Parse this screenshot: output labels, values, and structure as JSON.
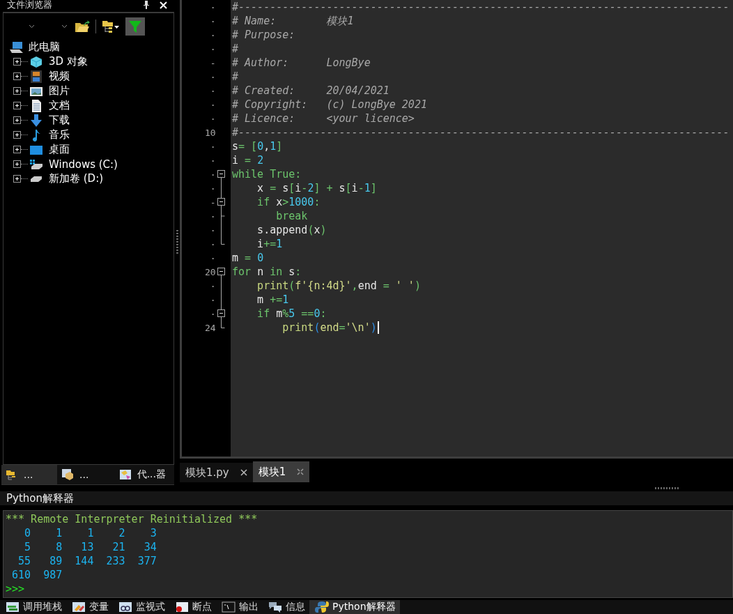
{
  "file_browser": {
    "title": "文件浏览器",
    "filter_on": true,
    "tree": {
      "label": "此电脑",
      "kind": "computer",
      "expanded": true,
      "children": [
        {
          "label": "3D 对象",
          "kind": "cube",
          "expanded": false
        },
        {
          "label": "视频",
          "kind": "film",
          "expanded": false
        },
        {
          "label": "图片",
          "kind": "image",
          "expanded": false
        },
        {
          "label": "文档",
          "kind": "doc",
          "expanded": false
        },
        {
          "label": "下载",
          "kind": "download",
          "expanded": false
        },
        {
          "label": "音乐",
          "kind": "music",
          "expanded": false
        },
        {
          "label": "桌面",
          "kind": "desktop",
          "expanded": false
        },
        {
          "label": "Windows (C:)",
          "kind": "windrive",
          "expanded": false
        },
        {
          "label": "新加卷 (D:)",
          "kind": "drive",
          "expanded": false
        }
      ]
    },
    "tabs": [
      {
        "label": "...",
        "kind": "folder",
        "selected": true
      },
      {
        "label": "...",
        "kind": "box",
        "selected": false
      },
      {
        "label": "代...器",
        "kind": "code",
        "selected": false
      }
    ]
  },
  "editor": {
    "lines": [
      {
        "gutter": "·",
        "tokens": [
          {
            "kind": "comment",
            "text": "#------------------------------------------------------------------------------"
          }
        ]
      },
      {
        "gutter": "·",
        "tokens": [
          {
            "kind": "comment",
            "text": "# Name:        模块1"
          }
        ]
      },
      {
        "gutter": "·",
        "tokens": [
          {
            "kind": "comment",
            "text": "# Purpose:"
          }
        ]
      },
      {
        "gutter": "·",
        "tokens": [
          {
            "kind": "comment",
            "text": "#"
          }
        ]
      },
      {
        "gutter": "-",
        "tokens": [
          {
            "kind": "comment",
            "text": "# Author:      LongBye"
          }
        ]
      },
      {
        "gutter": "·",
        "tokens": [
          {
            "kind": "comment",
            "text": "#"
          }
        ]
      },
      {
        "gutter": "·",
        "tokens": [
          {
            "kind": "comment",
            "text": "# Created:     20/04/2021"
          }
        ]
      },
      {
        "gutter": "·",
        "tokens": [
          {
            "kind": "comment",
            "text": "# Copyright:   (c) LongBye 2021"
          }
        ]
      },
      {
        "gutter": "·",
        "tokens": [
          {
            "kind": "comment",
            "text": "# Licence:     <your licence>"
          }
        ]
      },
      {
        "gutter": "10",
        "tokens": [
          {
            "kind": "comment",
            "text": "#------------------------------------------------------------------------------"
          }
        ]
      },
      {
        "gutter": "·",
        "tokens": [
          {
            "kind": "name",
            "text": "s"
          },
          {
            "kind": "op",
            "text": "= ["
          },
          {
            "kind": "number",
            "text": "0"
          },
          {
            "kind": "name",
            "text": ","
          },
          {
            "kind": "number",
            "text": "1"
          },
          {
            "kind": "op",
            "text": "]"
          }
        ]
      },
      {
        "gutter": "·",
        "tokens": [
          {
            "kind": "name",
            "text": "i "
          },
          {
            "kind": "op",
            "text": "= "
          },
          {
            "kind": "number",
            "text": "2"
          }
        ]
      },
      {
        "gutter": "·",
        "fold": {
          "kind": "open"
        },
        "tokens": [
          {
            "kind": "keyword",
            "text": "while True:"
          }
        ]
      },
      {
        "gutter": "·",
        "fold": {
          "kind": "bar"
        },
        "tokens": [
          {
            "kind": "name",
            "text": "    x "
          },
          {
            "kind": "op",
            "text": "= "
          },
          {
            "kind": "name",
            "text": "s"
          },
          {
            "kind": "op",
            "text": "["
          },
          {
            "kind": "name",
            "text": "i"
          },
          {
            "kind": "op",
            "text": "-"
          },
          {
            "kind": "number",
            "text": "2"
          },
          {
            "kind": "op",
            "text": "] + "
          },
          {
            "kind": "name",
            "text": "s"
          },
          {
            "kind": "op",
            "text": "["
          },
          {
            "kind": "name",
            "text": "i"
          },
          {
            "kind": "op",
            "text": "-"
          },
          {
            "kind": "number",
            "text": "1"
          },
          {
            "kind": "op",
            "text": "]"
          }
        ]
      },
      {
        "gutter": "-",
        "fold": {
          "kind": "open"
        },
        "tokens": [
          {
            "kind": "keyword",
            "text": "    if "
          },
          {
            "kind": "name",
            "text": "x"
          },
          {
            "kind": "op",
            "text": ">"
          },
          {
            "kind": "number",
            "text": "1000"
          },
          {
            "kind": "op",
            "text": ":"
          }
        ]
      },
      {
        "gutter": "·",
        "fold": {
          "kind": "tee"
        },
        "tokens": [
          {
            "kind": "keyword",
            "text": "       break"
          }
        ]
      },
      {
        "gutter": "·",
        "fold": {
          "kind": "bar"
        },
        "tokens": [
          {
            "kind": "name",
            "text": "    s.append"
          },
          {
            "kind": "op",
            "text": "("
          },
          {
            "kind": "name",
            "text": "x"
          },
          {
            "kind": "op",
            "text": ")"
          }
        ]
      },
      {
        "gutter": "·",
        "fold": {
          "kind": "end"
        },
        "tokens": [
          {
            "kind": "name",
            "text": "    i"
          },
          {
            "kind": "op",
            "text": "+="
          },
          {
            "kind": "number",
            "text": "1"
          }
        ]
      },
      {
        "gutter": "·",
        "tokens": [
          {
            "kind": "name",
            "text": "m "
          },
          {
            "kind": "op",
            "text": "= "
          },
          {
            "kind": "number",
            "text": "0"
          }
        ]
      },
      {
        "gutter": "20",
        "fold": {
          "kind": "open"
        },
        "tokens": [
          {
            "kind": "keyword",
            "text": "for "
          },
          {
            "kind": "name",
            "text": "n "
          },
          {
            "kind": "keyword",
            "text": "in "
          },
          {
            "kind": "name",
            "text": "s"
          },
          {
            "kind": "op",
            "text": ":"
          }
        ]
      },
      {
        "gutter": "·",
        "fold": {
          "kind": "bar"
        },
        "tokens": [
          {
            "kind": "builtin",
            "text": "    print"
          },
          {
            "kind": "op",
            "text": "("
          },
          {
            "kind": "string",
            "text": "f'{n:4d}'"
          },
          {
            "kind": "op",
            "text": ","
          },
          {
            "kind": "name",
            "text": "end "
          },
          {
            "kind": "op",
            "text": "= "
          },
          {
            "kind": "string",
            "text": "' '"
          },
          {
            "kind": "op",
            "text": ")"
          }
        ]
      },
      {
        "gutter": "·",
        "fold": {
          "kind": "bar"
        },
        "tokens": [
          {
            "kind": "name",
            "text": "    m "
          },
          {
            "kind": "op",
            "text": "+="
          },
          {
            "kind": "number",
            "text": "1"
          }
        ]
      },
      {
        "gutter": "·",
        "fold": {
          "kind": "open"
        },
        "tokens": [
          {
            "kind": "keyword",
            "text": "    if "
          },
          {
            "kind": "name",
            "text": "m"
          },
          {
            "kind": "op",
            "text": "%"
          },
          {
            "kind": "number",
            "text": "5 "
          },
          {
            "kind": "op",
            "text": "=="
          },
          {
            "kind": "number",
            "text": "0"
          },
          {
            "kind": "op",
            "text": ":"
          }
        ]
      },
      {
        "gutter": "24",
        "fold": {
          "kind": "end"
        },
        "cursor": true,
        "tokens": [
          {
            "kind": "builtin",
            "text": "        print"
          },
          {
            "kind": "paren",
            "text": "("
          },
          {
            "kind": "string",
            "text": "end"
          },
          {
            "kind": "op",
            "text": "="
          },
          {
            "kind": "string",
            "text": "'\\n'"
          },
          {
            "kind": "paren",
            "text": ")"
          }
        ]
      }
    ],
    "tabs": [
      {
        "label": "模块1.py",
        "selected": false
      },
      {
        "label": "模块1",
        "selected": true
      }
    ]
  },
  "interpreter": {
    "title": "Python解释器",
    "lines": [
      {
        "kind": "banner",
        "text": "*** Remote Interpreter Reinitialized ***"
      },
      {
        "kind": "output",
        "text": "   0    1    1    2    3"
      },
      {
        "kind": "output",
        "text": "   5    8   13   21   34"
      },
      {
        "kind": "output",
        "text": "  55   89  144  233  377"
      },
      {
        "kind": "output",
        "text": " 610  987"
      },
      {
        "kind": "prompt",
        "text": ">>>"
      }
    ]
  },
  "bottom_tabs": [
    {
      "label": "调用堆栈",
      "kind": "stack",
      "selected": false
    },
    {
      "label": "变量",
      "kind": "vars",
      "selected": false
    },
    {
      "label": "监视式",
      "kind": "watch",
      "selected": false
    },
    {
      "label": "断点",
      "kind": "breakpoint",
      "selected": false
    },
    {
      "label": "输出",
      "kind": "console",
      "selected": false
    },
    {
      "label": "信息",
      "kind": "message",
      "selected": false
    },
    {
      "label": "Python解释器",
      "kind": "python",
      "selected": true
    }
  ]
}
